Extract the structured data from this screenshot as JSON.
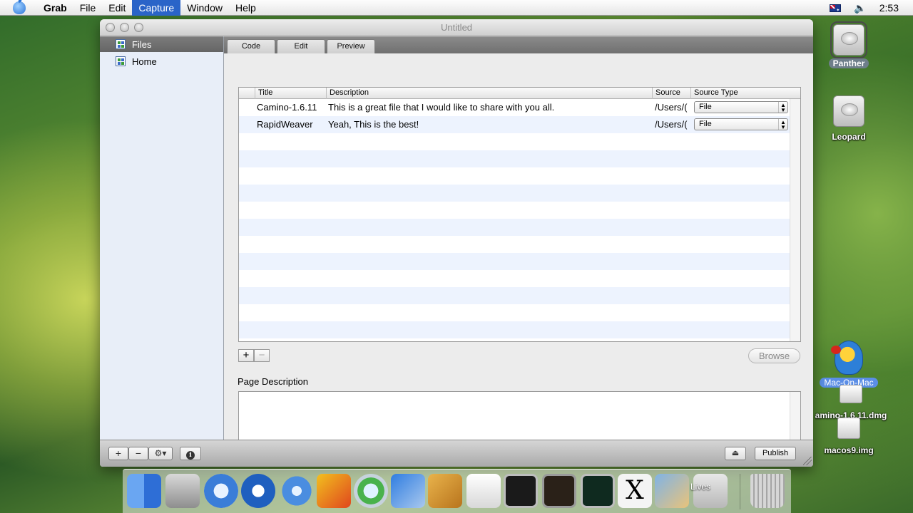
{
  "menubar": {
    "app_name": "Grab",
    "items": [
      "File",
      "Edit",
      "Capture",
      "Window",
      "Help"
    ],
    "active_item": "Capture",
    "clock": "2:53",
    "icons": [
      "apple-icon",
      "flag-icon",
      "volume-icon"
    ]
  },
  "window": {
    "title": "Untitled",
    "sidebar": {
      "items": [
        {
          "label": "Files",
          "selected": true
        },
        {
          "label": "Home",
          "selected": false
        }
      ]
    },
    "tabs": [
      "Code",
      "Edit",
      "Preview"
    ],
    "table": {
      "columns": [
        "Title",
        "Description",
        "Source",
        "Source Type"
      ],
      "rows": [
        {
          "title": "Camino-1.6.11",
          "description": "This is a great file that I would like to share with you all.",
          "source": "/Users/(",
          "source_type": "File"
        },
        {
          "title": "RapidWeaver",
          "description": "Yeah, This is the best!",
          "source": "/Users/(",
          "source_type": "File"
        }
      ]
    },
    "buttons": {
      "add": "+",
      "remove": "−",
      "browse": "Browse",
      "publish": "Publish",
      "gear": "⚙▾"
    },
    "page_description": {
      "label": "Page Description",
      "value": ""
    }
  },
  "desktop": {
    "icons": [
      {
        "label": "Panther",
        "type": "hard-drive",
        "selected": true
      },
      {
        "label": "Leopard",
        "type": "hard-drive"
      },
      {
        "label": "Mac-On-Mac",
        "type": "application",
        "selected": true
      },
      {
        "label": "amino-1.6.11.dmg",
        "type": "disk-image"
      },
      {
        "label": "macos9.img",
        "type": "disk-image"
      }
    ]
  },
  "dock": {
    "label": "Lives",
    "icons": [
      "finder-icon",
      "system-preferences-icon",
      "safari-icon",
      "1password-icon",
      "network-icon",
      "taxi-icon",
      "itunes-icon",
      "xcode-icon",
      "text-editor-icon",
      "textedit-icon",
      "terminal-icon",
      "console-icon",
      "activity-monitor-icon",
      "x11-icon",
      "preview-icon",
      "documents-stack-icon",
      "trash-icon"
    ]
  },
  "colors": {
    "menu_highlight": "#2a64c8",
    "sidebar_bg": "#e8eef8",
    "sidebar_selected": "#6f6f6f",
    "row_alt": "#edf3fe"
  }
}
